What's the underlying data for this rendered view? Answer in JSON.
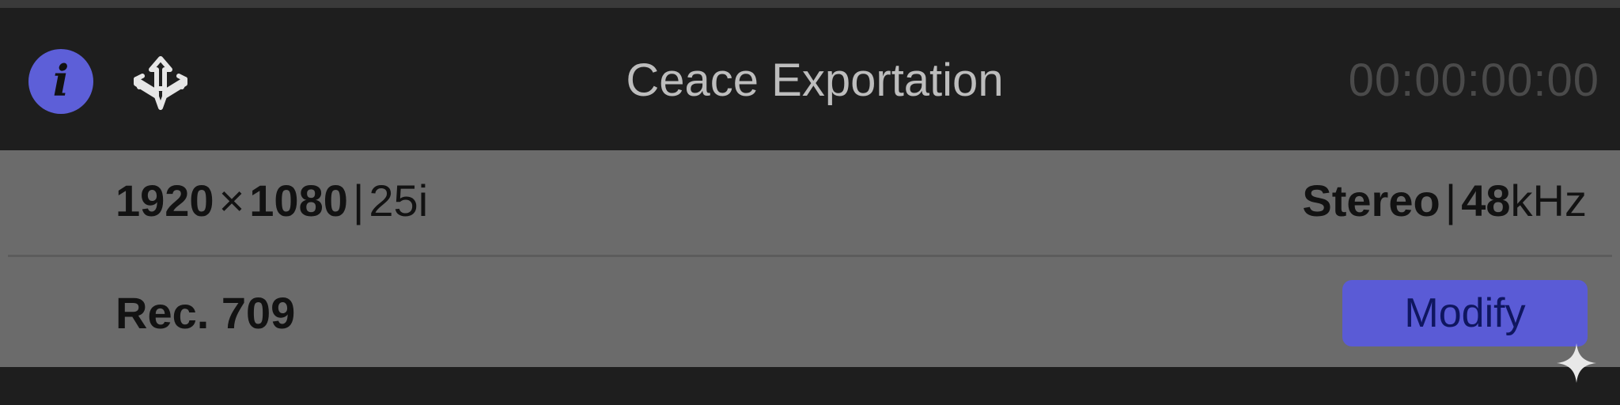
{
  "header": {
    "info_icon": "info-icon",
    "info_glyph": "i",
    "share_icon": "share-arrows-icon",
    "title": "Ceace Exportation",
    "timecode": "00:00:00:00"
  },
  "format": {
    "resolution_width": "1920",
    "resolution_times": "×",
    "resolution_height": "1080",
    "separator": "|",
    "frame_rate": "25i",
    "audio_channels": "Stereo",
    "audio_rate_value": "48",
    "audio_rate_unit": "kHz",
    "color_space": "Rec. 709"
  },
  "actions": {
    "modify_label": "Modify"
  },
  "colors": {
    "accent": "#5d5fd8",
    "panel": "#6b6b6b",
    "background": "#1e1e1e"
  }
}
